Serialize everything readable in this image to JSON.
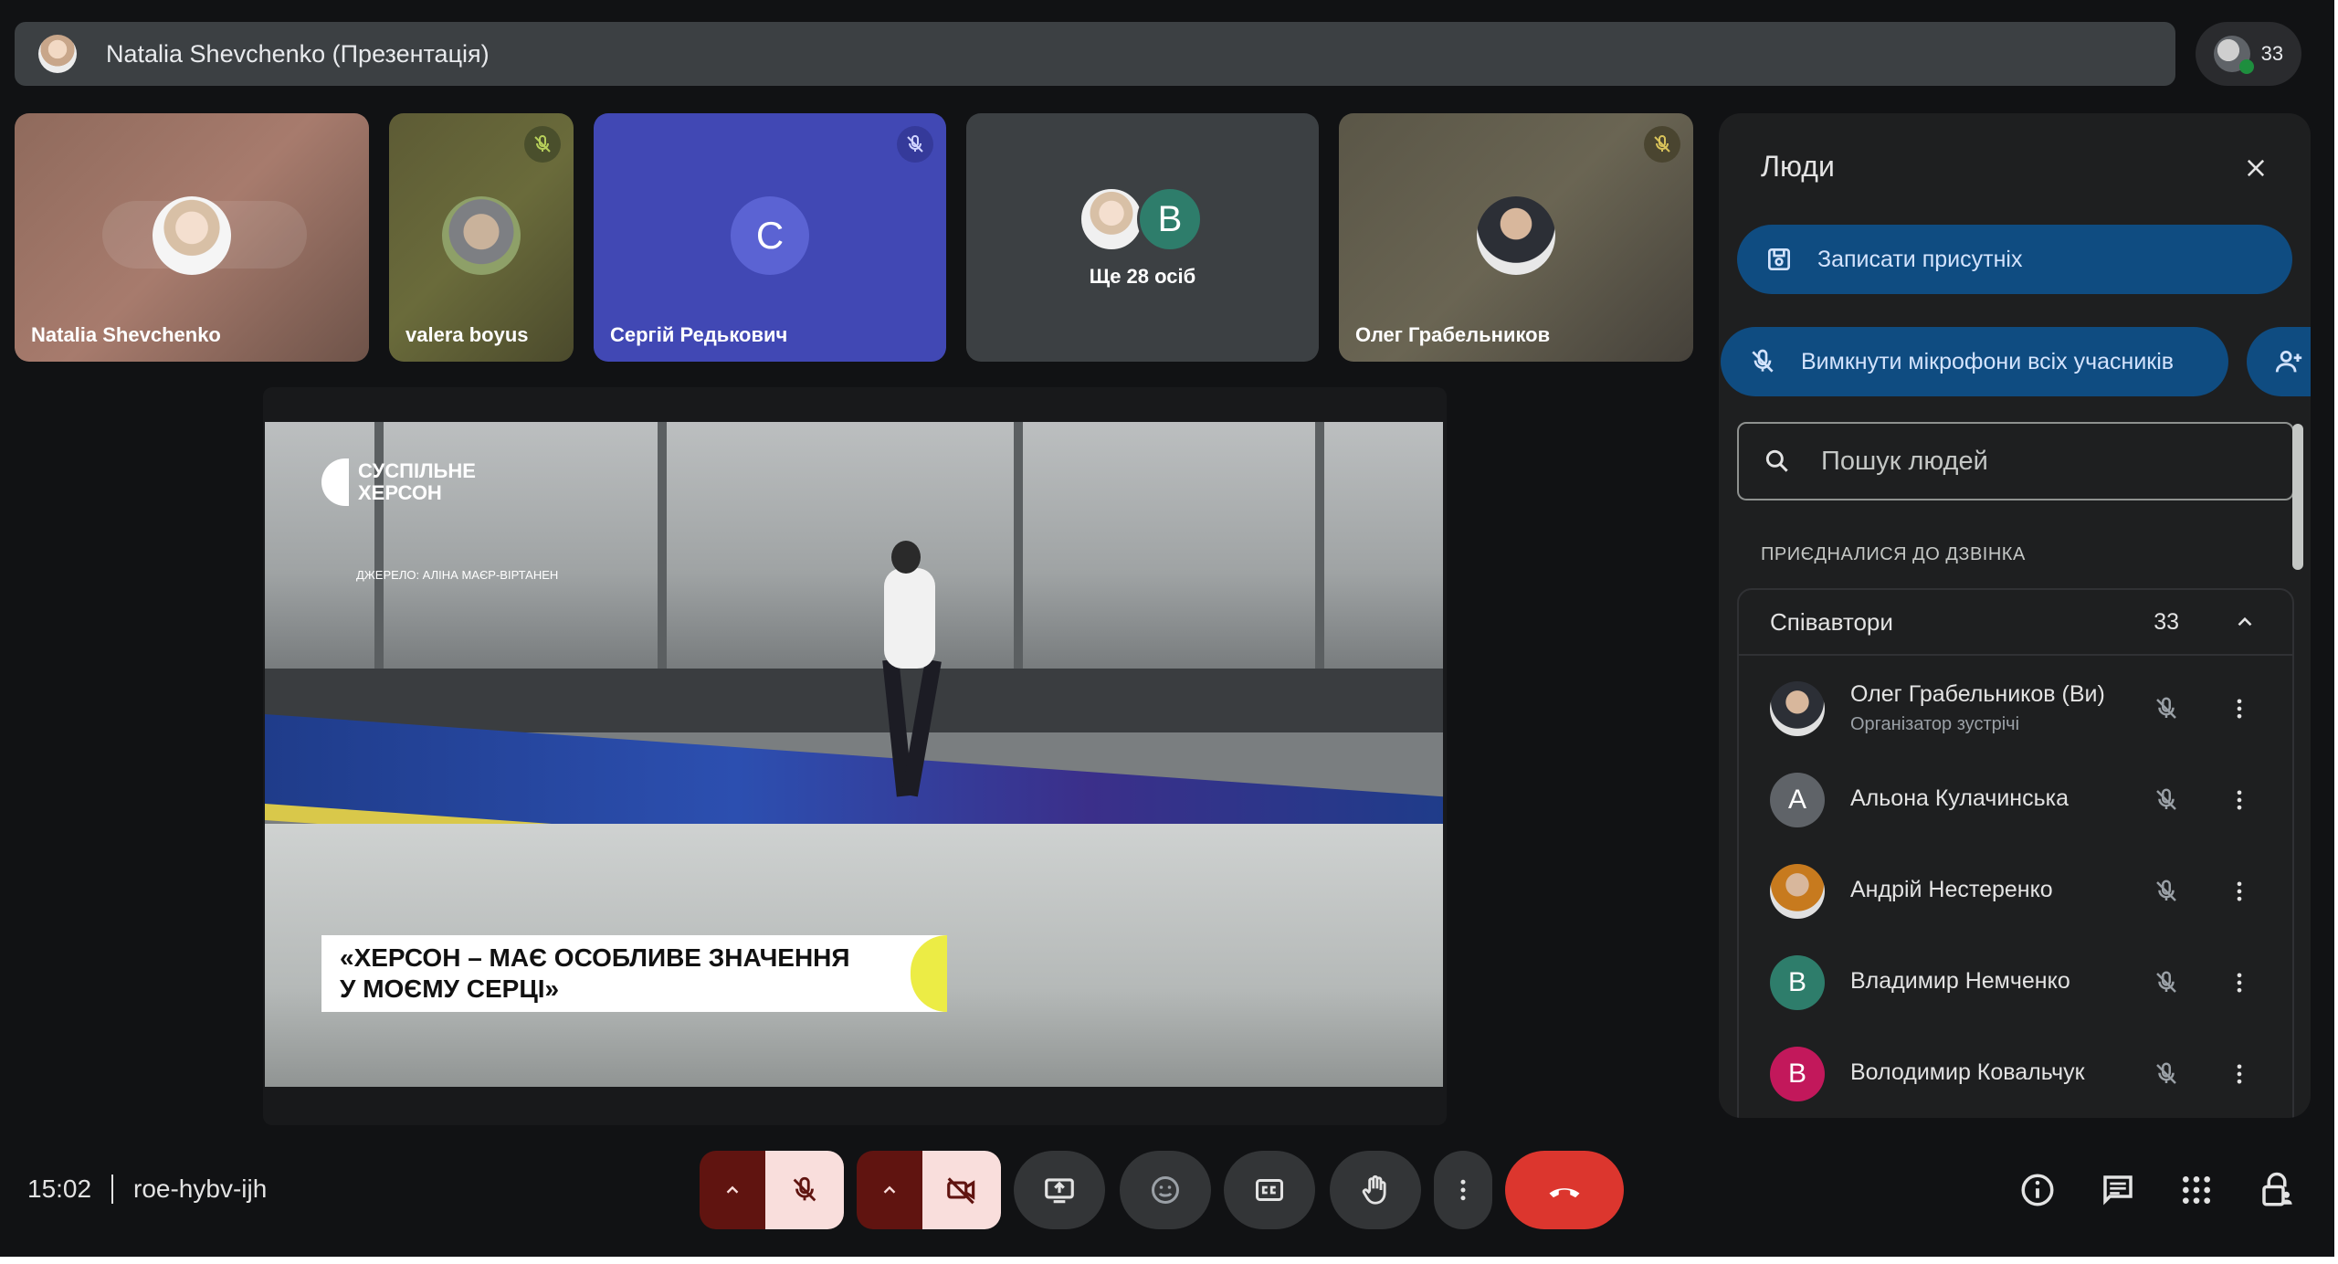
{
  "presentation_banner": {
    "title": "Natalia Shevchenko (Презентація)"
  },
  "participants_count": "33",
  "tiles": [
    {
      "name": "Natalia Shevchenko"
    },
    {
      "name": "valera boyus"
    },
    {
      "name": "Сергій Редькович",
      "initial": "С"
    },
    {
      "name": "",
      "initial": "В",
      "more_label": "Ще 28 осіб"
    },
    {
      "name": "Олег Грабельников"
    }
  ],
  "stage": {
    "logo_line1": "СУСПІЛЬНЕ",
    "logo_line2": "ХЕРСОН",
    "source": "ДЖЕРЕЛО: АЛІНА МАЄР-ВІРТАНЕН",
    "caption_line1": "«ХЕРСОН – МАЄ ОСОБЛИВЕ ЗНАЧЕННЯ",
    "caption_line2": "У МОЄМУ СЕРЦІ»"
  },
  "people_panel": {
    "title": "Люди",
    "record_label": "Записати присутніх",
    "mute_all_label": "Вимкнути мікрофони всіх учасників",
    "search_placeholder": "Пошук людей",
    "section_label": "ПРИЄДНАЛИСЯ ДО ДЗВІНКА",
    "group_name": "Співавтори",
    "group_count": "33",
    "people": [
      {
        "name": "Олег Грабельников (Ви)",
        "subtitle": "Організатор зустрічі",
        "initial": "",
        "color": "#2c2f36"
      },
      {
        "name": "Альона Кулачинська",
        "subtitle": "",
        "initial": "А",
        "color": "#5f6368"
      },
      {
        "name": "Андрій Нестеренко",
        "subtitle": "",
        "initial": "",
        "color": "#c77a1e"
      },
      {
        "name": "Владимир Немченко",
        "subtitle": "",
        "initial": "В",
        "color": "#2e7d6b"
      },
      {
        "name": "Володимир Ковальчук",
        "subtitle": "",
        "initial": "В",
        "color": "#c2185b"
      }
    ]
  },
  "bottom_bar": {
    "time": "15:02",
    "meeting_code": "roe-hybv-ijh"
  }
}
